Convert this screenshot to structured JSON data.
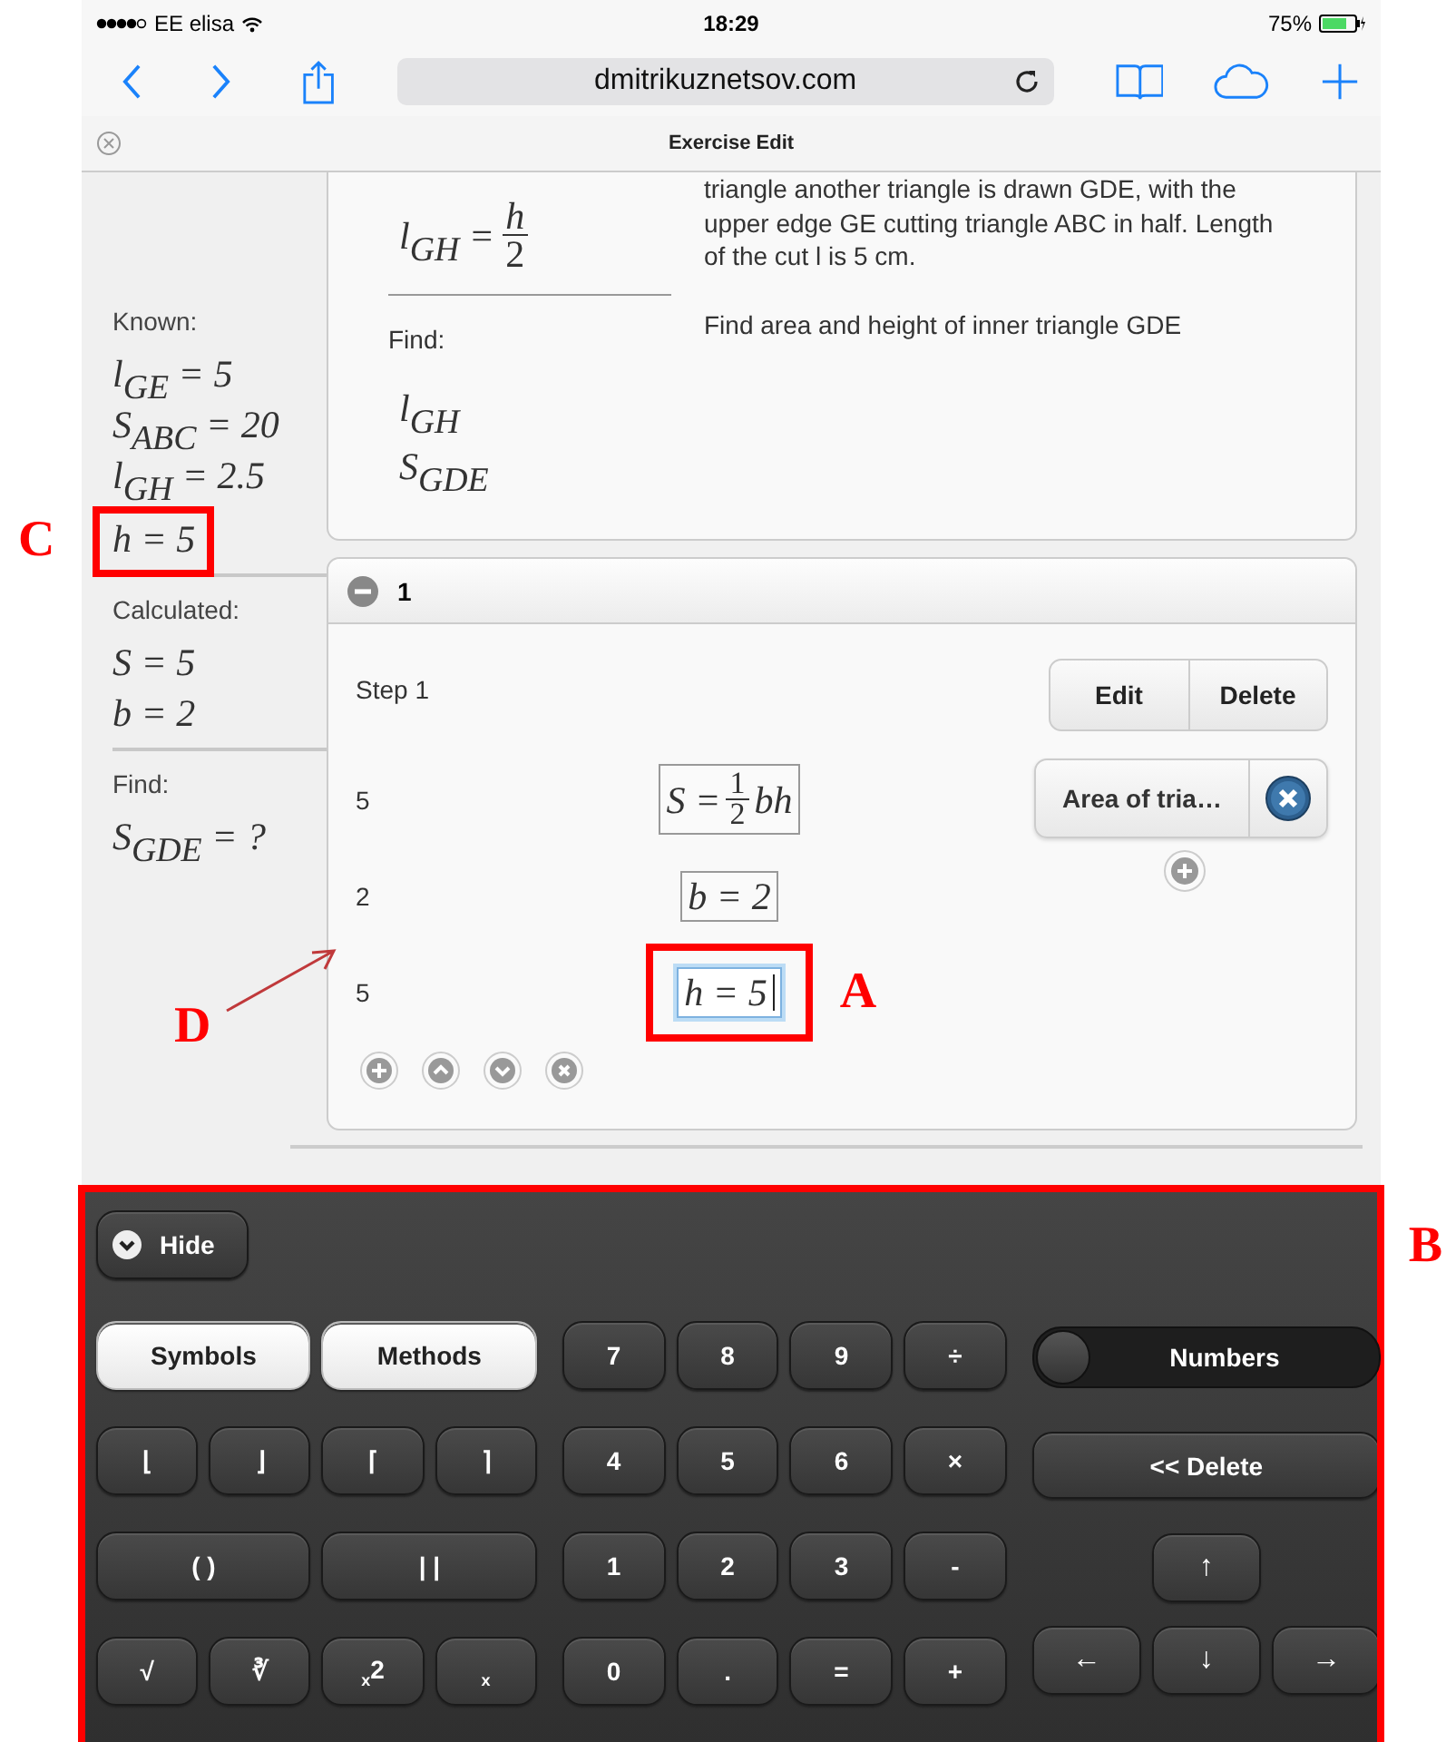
{
  "status_bar": {
    "carrier": "EE elisa",
    "time": "18:29",
    "battery": "75%"
  },
  "browser": {
    "url": "dmitrikuznetsov.com"
  },
  "tab": {
    "title": "Exercise Edit"
  },
  "sidebar": {
    "sections": [
      {
        "heading": "Known:",
        "items": [
          {
            "text": "l$_{GE}$ = 5"
          },
          {
            "text": "S$_{ABC}$ = 20"
          },
          {
            "text": "l$_{GH}$ = 2.5"
          },
          {
            "text": "h = 5",
            "callout": "C"
          }
        ]
      },
      {
        "heading": "Calculated:",
        "items": [
          {
            "text": "S = 5"
          },
          {
            "text": "b = 2"
          }
        ]
      },
      {
        "heading": "Find:",
        "items": [
          {
            "text": "S$_{GDE}$ = ?"
          }
        ]
      }
    ]
  },
  "problem": {
    "given_formula": {
      "lhs": "l$_{GH}$ =",
      "num": "h",
      "den": "2"
    },
    "find_label": "Find:",
    "find_items": [
      "l$_{GH}$",
      "S$_{GDE}$"
    ],
    "description": "triangle another triangle is drawn GDE, with the upper edge GE cutting triangle ABC in half. Length of the cut l is 5 cm.",
    "find_text": "Find area and height of inner triangle GDE"
  },
  "step_group": {
    "title": "1",
    "expanded": true,
    "step_label": "Step 1",
    "actions": [
      "Edit",
      "Delete"
    ],
    "method": "Area of tria…",
    "rows": [
      {
        "value": "5",
        "formula": {
          "lhs": "S =",
          "num": "1",
          "den": "2",
          "rhs": "bh"
        },
        "focused": false
      },
      {
        "value": "2",
        "formula": {
          "lhs": "b = 2"
        },
        "focused": false
      },
      {
        "value": "5",
        "formula": {
          "lhs": "h = 5"
        },
        "focused": true,
        "callout": "A",
        "pointer": "D"
      }
    ]
  },
  "keyboard": {
    "hide": "Hide",
    "callout": "B",
    "mode_buttons": [
      "Symbols",
      "Methods"
    ],
    "symbol_keys": [
      {
        "label": "⌊",
        "wide": false
      },
      {
        "label": "⌋",
        "wide": false
      },
      {
        "label": "⌈",
        "wide": false
      },
      {
        "label": "⌉",
        "wide": false
      },
      {
        "label": "( )",
        "wide": true
      },
      {
        "label": "| |",
        "wide": true
      },
      {
        "label": "√",
        "wide": false
      },
      {
        "label": "∛",
        "wide": false
      },
      {
        "label": "$_{x}$2",
        "wide": false
      },
      {
        "label": "$_{x}$",
        "wide": false
      }
    ],
    "number_keys": [
      "7",
      "8",
      "9",
      "÷",
      "4",
      "5",
      "6",
      "×",
      "1",
      "2",
      "3",
      "-",
      "0",
      ".",
      "=",
      "+"
    ],
    "toggle": {
      "label": "Numbers",
      "on": false
    },
    "delete": "<< Delete",
    "arrows": [
      "↑",
      "←",
      "↓",
      "→"
    ]
  }
}
